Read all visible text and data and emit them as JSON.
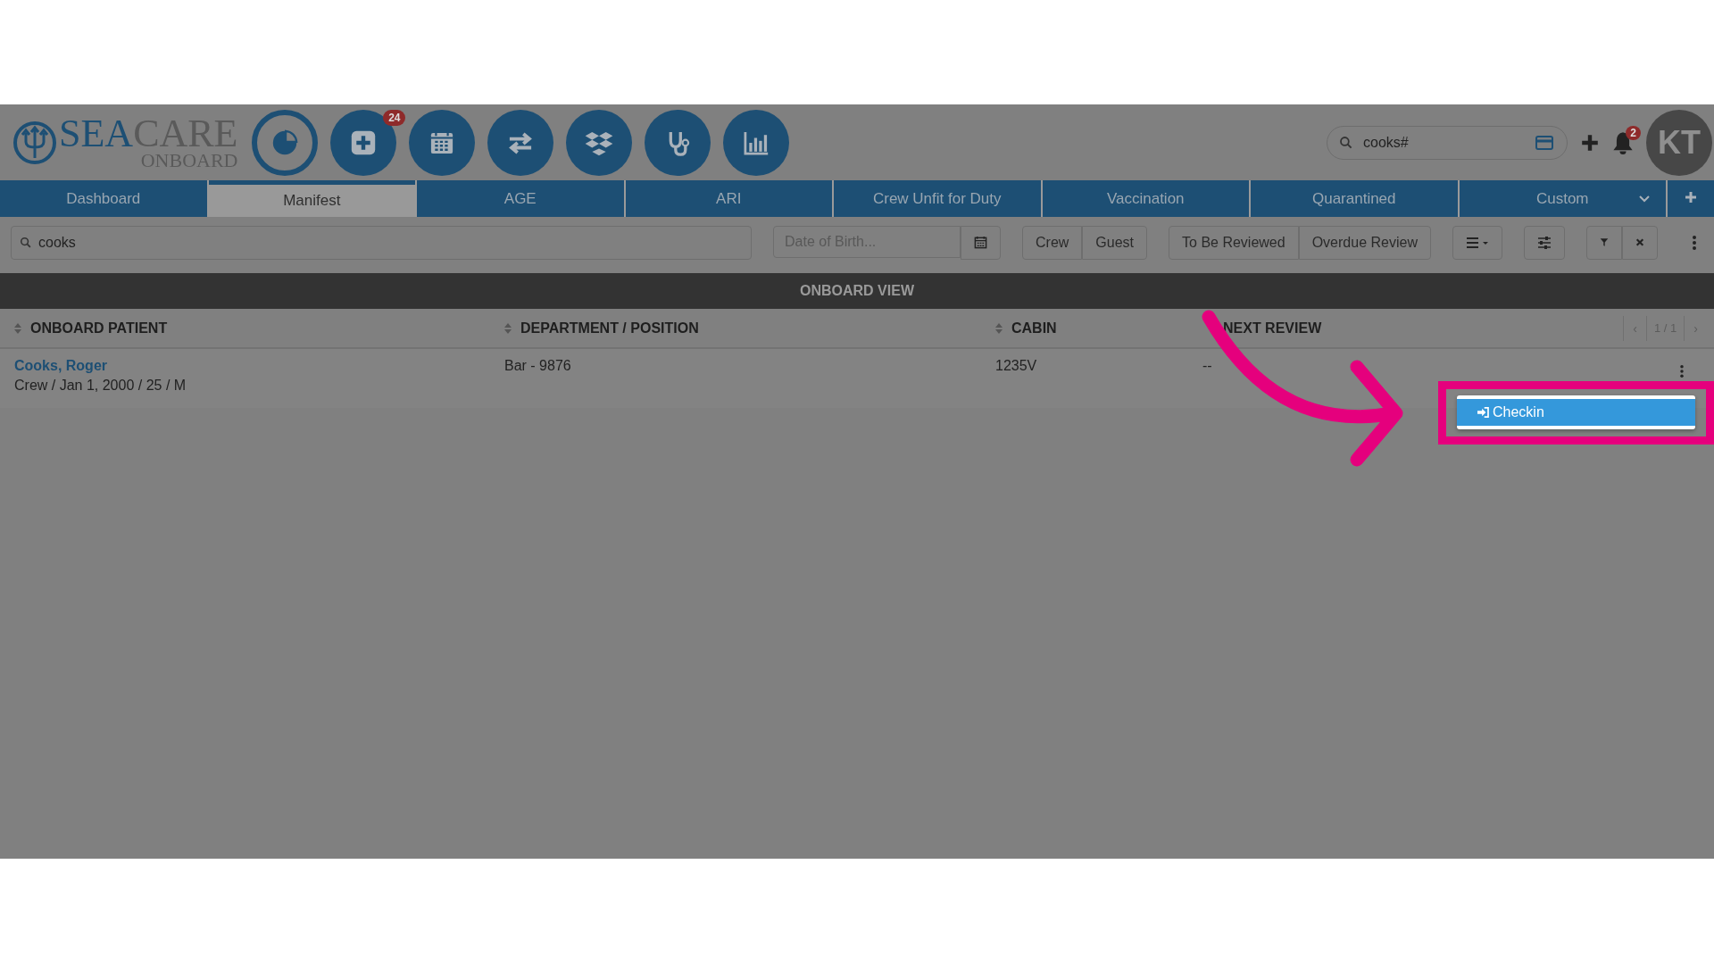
{
  "header": {
    "logo": {
      "word_1": "SEA",
      "word_2": "CARE",
      "tagline": "ONBOARD"
    },
    "nav_icons": [
      {
        "kind": "pie"
      },
      {
        "kind": "plus",
        "badge": "24"
      },
      {
        "kind": "calendar"
      },
      {
        "kind": "transfer"
      },
      {
        "kind": "boxes"
      },
      {
        "kind": "stethoscope"
      },
      {
        "kind": "chart"
      }
    ],
    "search": {
      "value": "cooks#"
    },
    "notifications": {
      "badge": "2"
    },
    "avatar": {
      "initials": "KT"
    }
  },
  "tabs": [
    {
      "label": "Dashboard",
      "selected": false
    },
    {
      "label": "Manifest",
      "selected": true
    },
    {
      "label": "AGE",
      "selected": false
    },
    {
      "label": "ARI",
      "selected": false
    },
    {
      "label": "Crew Unfit for Duty",
      "selected": false
    },
    {
      "label": "Vaccination",
      "selected": false
    },
    {
      "label": "Quarantined",
      "selected": false
    },
    {
      "label": "Custom",
      "selected": false,
      "dropdown": true
    }
  ],
  "toolbar": {
    "search": {
      "value": "cooks"
    },
    "date": {
      "placeholder": "Date of Birth..."
    },
    "type_filters": [
      "Crew",
      "Guest"
    ],
    "review_filters": [
      "To Be Reviewed",
      "Overdue Review"
    ]
  },
  "section_title": "ONBOARD VIEW",
  "table": {
    "columns": [
      {
        "label": "ONBOARD PATIENT",
        "sortable": true
      },
      {
        "label": "DEPARTMENT / POSITION",
        "sortable": true
      },
      {
        "label": "CABIN",
        "sortable": true
      },
      {
        "label": "NEXT REVIEW",
        "sortable": false
      }
    ],
    "pager": {
      "previous": "‹",
      "text": "1 / 1",
      "next": "›"
    },
    "rows": [
      {
        "name": "Cooks, Roger",
        "details": "Crew / Jan 1, 2000 / 25 / M",
        "department": "Bar - 9876",
        "cabin": "1235V",
        "next_review": "--"
      }
    ]
  },
  "row_menu": {
    "items": [
      {
        "label": "Checkin",
        "highlighted": true
      }
    ]
  }
}
